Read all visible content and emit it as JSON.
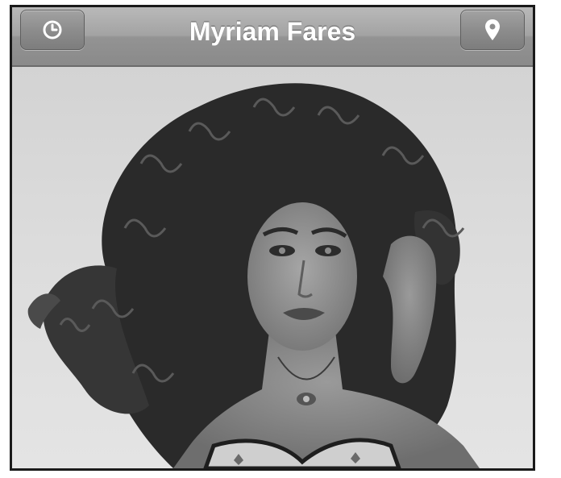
{
  "navbar": {
    "title": "Myriam Fares",
    "left_button_icon": "clock-icon",
    "right_button_icon": "location-pin-icon"
  },
  "content": {
    "image_icon": "portrait-photo"
  },
  "colors": {
    "navbar": "#9e9e9e",
    "title_text": "#ffffff",
    "frame_border": "#1a1a1a",
    "photo_background": "#d9d9d9"
  }
}
